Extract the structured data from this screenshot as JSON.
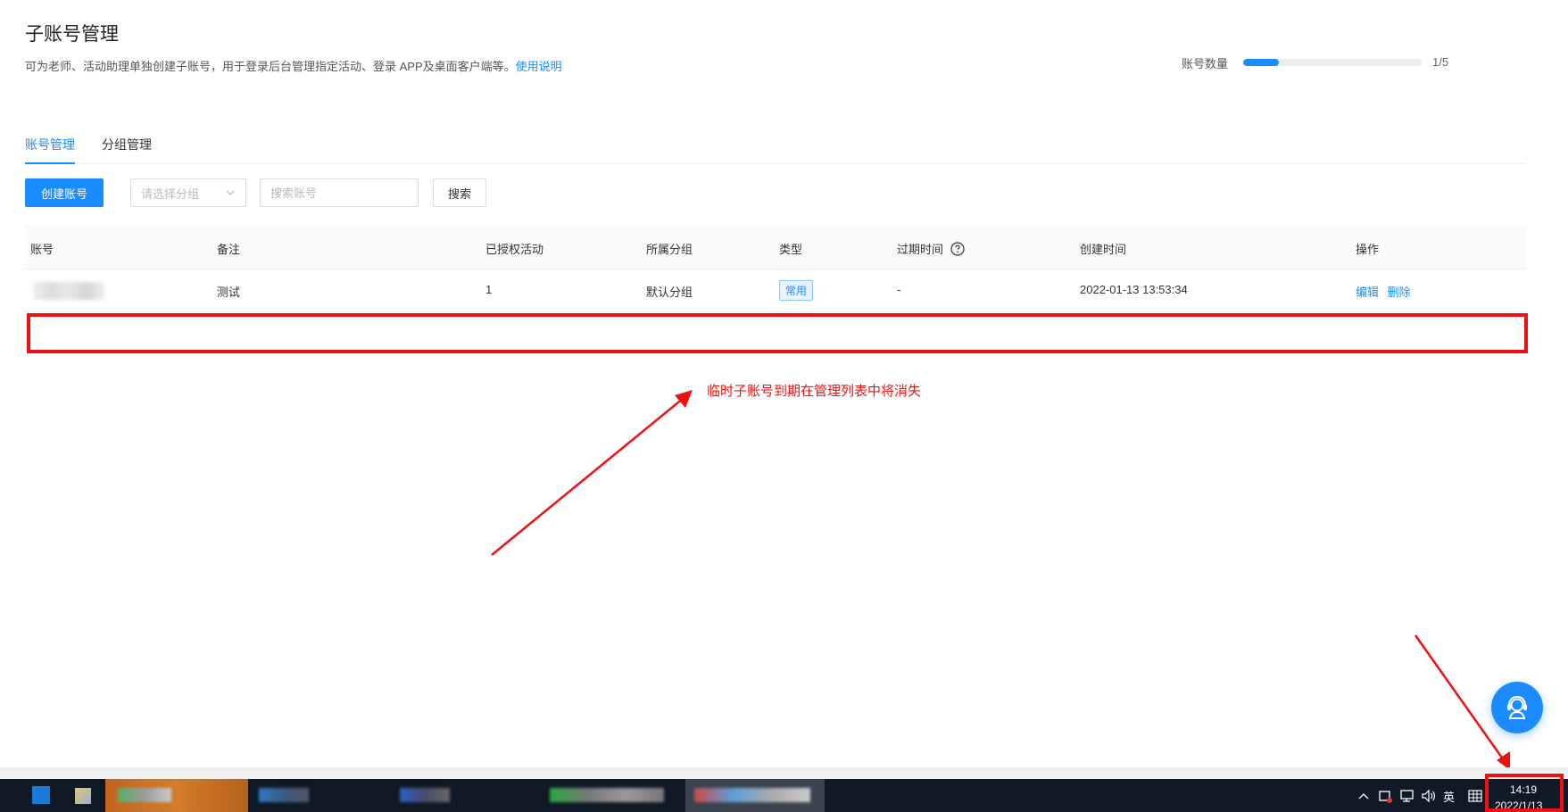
{
  "header": {
    "title": "子账号管理",
    "description": "可为老师、活动助理单独创建子账号，用于登录后台管理指定活动、登录 APP及桌面客户端等。",
    "help_link": "使用说明"
  },
  "account_quota": {
    "label": "账号数量",
    "used": 1,
    "total": 5,
    "fraction": 0.2,
    "display": "1/5",
    "color": "#1a8cff"
  },
  "tabs": [
    {
      "label": "账号管理",
      "active": true
    },
    {
      "label": "分组管理",
      "active": false
    }
  ],
  "toolbar": {
    "create_label": "创建账号",
    "group_select_placeholder": "请选择分组",
    "search_placeholder": "搜索账号",
    "search_label": "搜索"
  },
  "table": {
    "columns": [
      "账号",
      "备注",
      "已授权活动",
      "所属分组",
      "类型",
      "过期时间",
      "创建时间",
      "操作"
    ],
    "rows": [
      {
        "account": "",
        "note": "测试",
        "authorized": "1",
        "group": "默认分组",
        "type": "常用",
        "expire": "-",
        "created": "2022-01-13 13:53:34",
        "actions": [
          "编辑",
          "删除"
        ]
      }
    ]
  },
  "annotation": {
    "text": "临时子账号到期在管理列表中将消失",
    "color": "#ee1111"
  },
  "taskbar": {
    "ime": "英",
    "time": "14:19",
    "date": "2022/1/13"
  },
  "icons": [
    "help-circle-icon",
    "chevron-down-icon",
    "customer-service-icon",
    "windows-start-icon",
    "tray-up-icon",
    "network-icon",
    "volume-icon",
    "keyboard-icon"
  ]
}
